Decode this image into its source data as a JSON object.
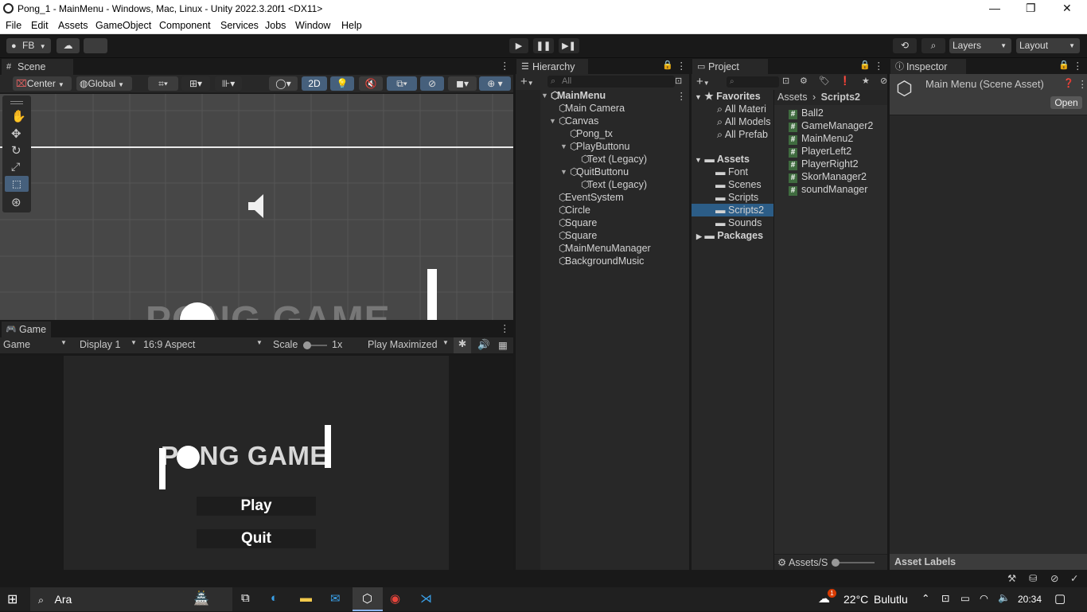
{
  "window": {
    "title": "Pong_1 - MainMenu - Windows, Mac, Linux - Unity 2022.3.20f1 <DX11>"
  },
  "menu": [
    "File",
    "Edit",
    "Assets",
    "GameObject",
    "Component",
    "Services",
    "Jobs",
    "Window",
    "Help"
  ],
  "toolbar": {
    "account": "FB",
    "layers": "Layers",
    "layout": "Layout"
  },
  "scene": {
    "tab": "Scene",
    "pivot": "Center",
    "space": "Global",
    "mode2d": "2D",
    "preview_text": "PONG GAME"
  },
  "game": {
    "tab": "Game",
    "view": "Game",
    "display": "Display 1",
    "aspect": "16:9 Aspect",
    "scale_label": "Scale",
    "scale_value": "1x",
    "play_mode": "Play Maximized",
    "title": "PONG GAME",
    "play": "Play",
    "quit": "Quit"
  },
  "hierarchy": {
    "tab": "Hierarchy",
    "search_placeholder": "All",
    "items": [
      {
        "label": "MainMenu",
        "depth": 0
      },
      {
        "label": "Main Camera",
        "depth": 1
      },
      {
        "label": "Canvas",
        "depth": 1
      },
      {
        "label": "Pong_tx",
        "depth": 2
      },
      {
        "label": "PlayButtonu",
        "depth": 2
      },
      {
        "label": "Text (Legacy)",
        "depth": 3
      },
      {
        "label": "QuitButtonu",
        "depth": 2
      },
      {
        "label": "Text (Legacy)",
        "depth": 3
      },
      {
        "label": "EventSystem",
        "depth": 1
      },
      {
        "label": "Circle",
        "depth": 1
      },
      {
        "label": "Square",
        "depth": 1
      },
      {
        "label": "Square",
        "depth": 1
      },
      {
        "label": "MainMenuManager",
        "depth": 1
      },
      {
        "label": "BackgroundMusic",
        "depth": 1
      }
    ]
  },
  "project": {
    "tab": "Project",
    "favorites_label": "Favorites",
    "favorites": [
      "All Materi",
      "All Models",
      "All Prefab"
    ],
    "assets_label": "Assets",
    "folders": [
      "Font",
      "Scenes",
      "Scripts",
      "Scripts2",
      "Sounds"
    ],
    "packages_label": "Packages",
    "breadcrumb_root": "Assets",
    "breadcrumb_current": "Scripts2",
    "files": [
      "Ball2",
      "GameManager2",
      "MainMenu2",
      "PlayerLeft2",
      "PlayerRight2",
      "SkorManager2",
      "soundManager"
    ],
    "footer_path": "Assets/S"
  },
  "inspector": {
    "tab": "Inspector",
    "asset_title": "Main Menu (Scene Asset)",
    "open_button": "Open",
    "asset_labels": "Asset Labels"
  },
  "taskbar": {
    "search": "Ara",
    "temperature": "22°C",
    "weather": "Bulutlu",
    "time": "20:34",
    "weather_badge": "1"
  }
}
